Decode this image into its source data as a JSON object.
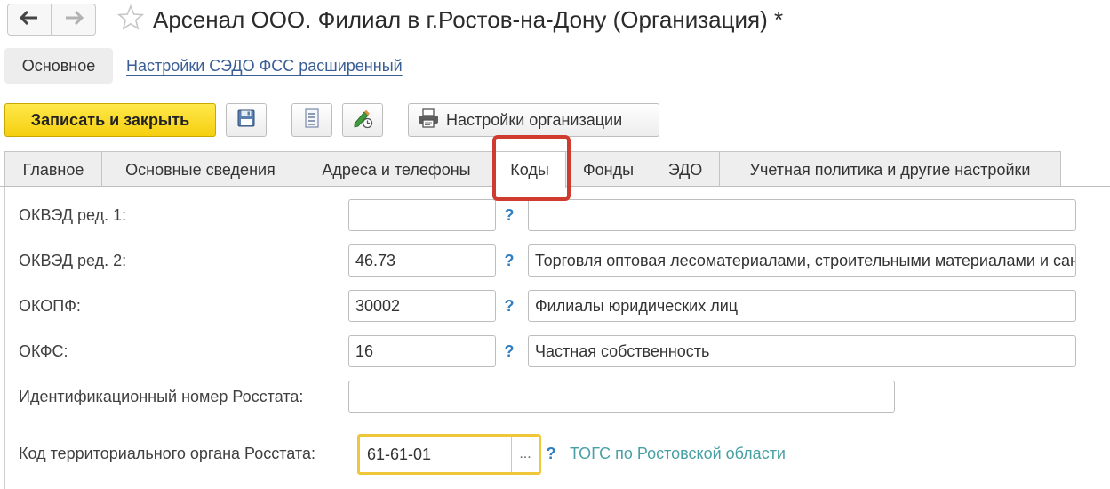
{
  "window": {
    "title": "Арсенал ООО. Филиал в г.Ростов-на-Дону (Организация) *"
  },
  "nav": {
    "back_icon": "arrow-left-icon",
    "forward_icon": "arrow-right-icon",
    "favorite_icon": "star-outline-icon"
  },
  "sections": {
    "main": "Основное",
    "link": "Настройки СЭДО ФСС расширенный"
  },
  "toolbar": {
    "save_close": "Записать и закрыть",
    "save_icon": "floppy-disk-icon",
    "list_icon": "document-list-icon",
    "edit_history_icon": "pencil-clock-icon",
    "settings_label": "Настройки организации",
    "settings_icon": "printer-icon"
  },
  "tabs": [
    {
      "label": "Главное",
      "active": false
    },
    {
      "label": "Основные сведения",
      "active": false
    },
    {
      "label": "Адреса и телефоны",
      "active": false
    },
    {
      "label": "Коды",
      "active": true
    },
    {
      "label": "Фонды",
      "active": false
    },
    {
      "label": "ЭДО",
      "active": false
    },
    {
      "label": "Учетная политика и другие настройки",
      "active": false
    }
  ],
  "highlight_color": "#d03b30",
  "fields": {
    "okved1": {
      "label": "ОКВЭД ред. 1:",
      "code": "",
      "description": "",
      "help": "?"
    },
    "okved2": {
      "label": "ОКВЭД ред. 2:",
      "code": "46.73",
      "description": "Торговля оптовая лесоматериалами, строительными материалами и санитарно-техническим оборудованием",
      "help": "?"
    },
    "okopf": {
      "label": "ОКОПФ:",
      "code": "30002",
      "description": "Филиалы юридических лиц",
      "help": "?"
    },
    "okfs": {
      "label": "ОКФС:",
      "code": "16",
      "description": "Частная собственность",
      "help": "?"
    },
    "rosstat_id": {
      "label": "Идентификационный номер Росстата:",
      "value": ""
    },
    "tog": {
      "label": "Код территориального органа Росстата:",
      "value": "61-61-01",
      "select": "...",
      "help": "?",
      "link": "ТОГС по Ростовской области"
    }
  }
}
